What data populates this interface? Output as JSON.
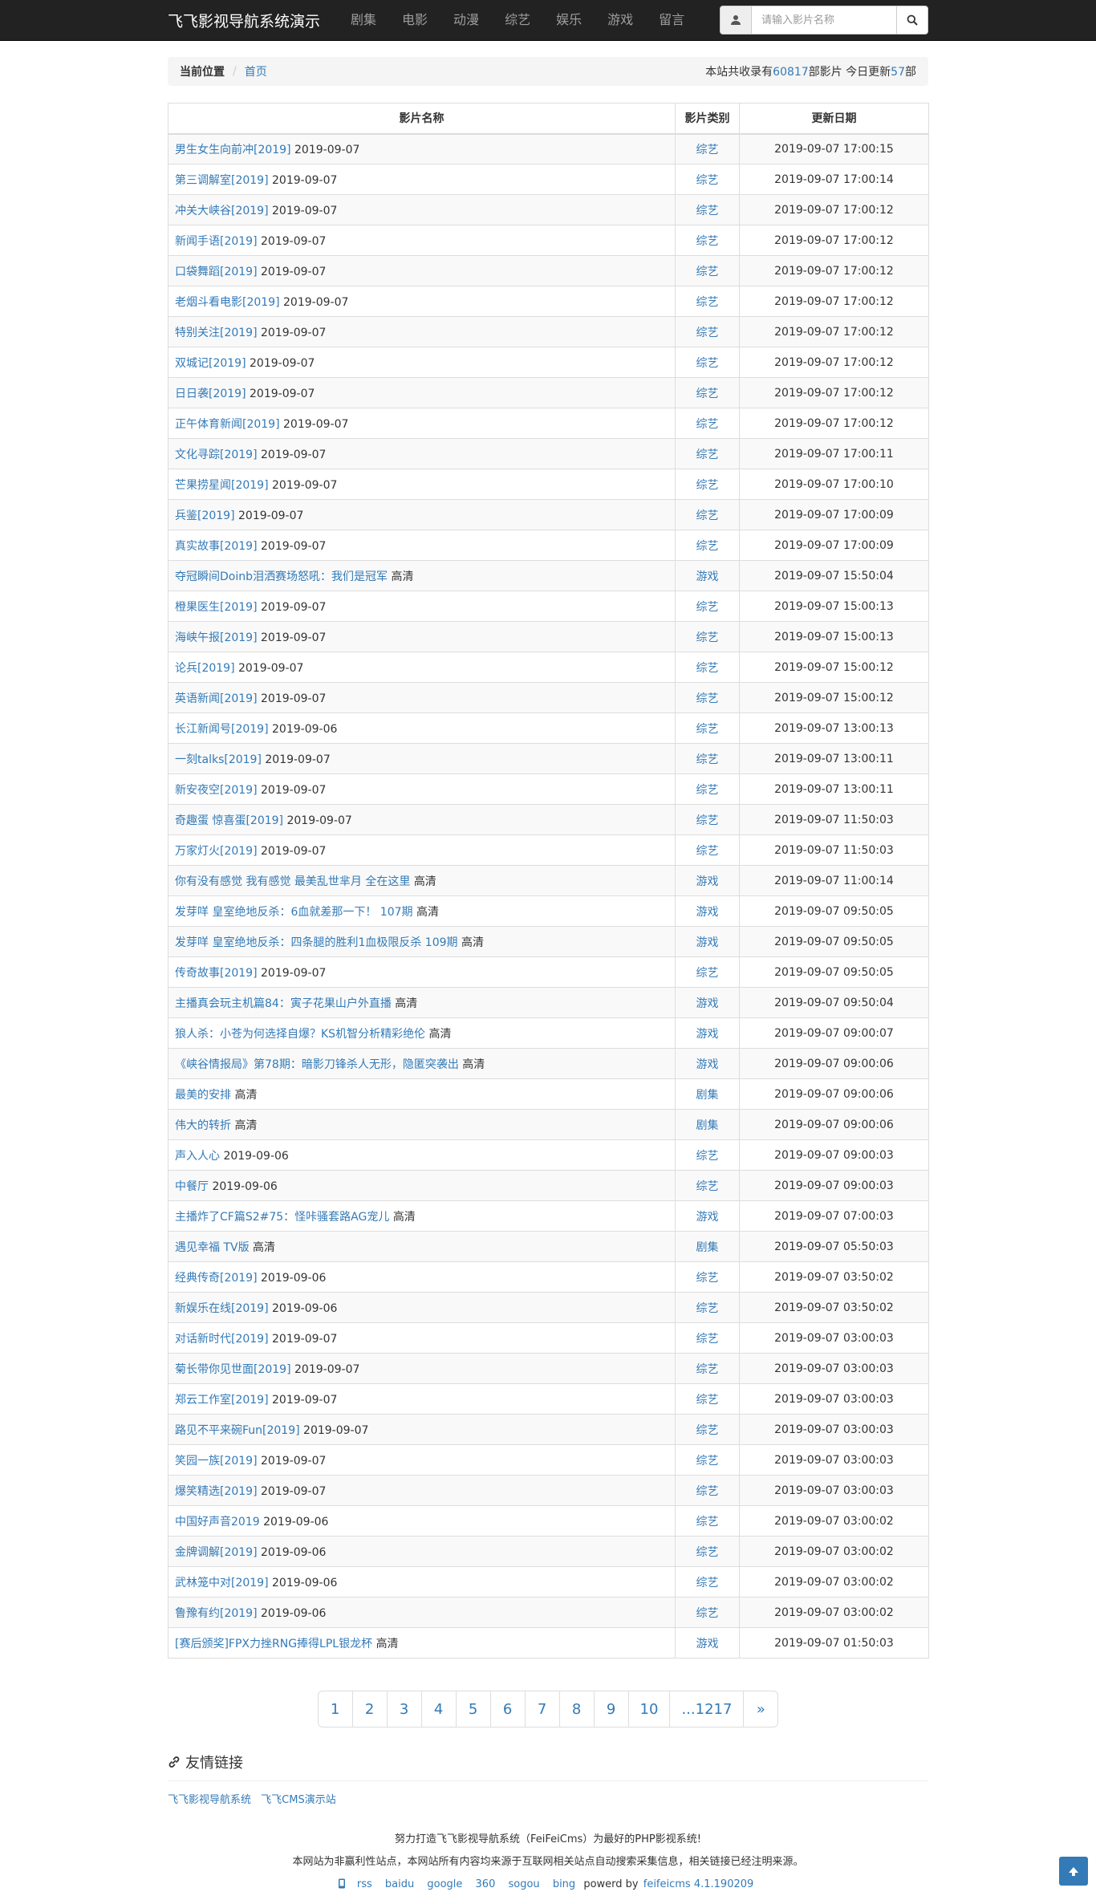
{
  "navbar": {
    "brand": "飞飞影视导航系统演示",
    "links": [
      "剧集",
      "电影",
      "动漫",
      "综艺",
      "娱乐",
      "游戏",
      "留言"
    ],
    "search_placeholder": "请输入影片名称"
  },
  "breadcrumb": {
    "current": "当前位置",
    "home": "首页",
    "stats_prefix": "本站共收录有",
    "total": "60817",
    "stats_mid": "部影片 今日更新",
    "today": "57",
    "stats_suffix": "部"
  },
  "table": {
    "headers": [
      "影片名称",
      "影片类别",
      "更新日期"
    ],
    "rows": [
      {
        "title": "男生女生向前冲[2019]",
        "note": "2019-09-07",
        "type": "综艺",
        "date": "2019-09-07 17:00:15"
      },
      {
        "title": "第三调解室[2019]",
        "note": "2019-09-07",
        "type": "综艺",
        "date": "2019-09-07 17:00:14"
      },
      {
        "title": "冲关大峡谷[2019]",
        "note": "2019-09-07",
        "type": "综艺",
        "date": "2019-09-07 17:00:12"
      },
      {
        "title": "新闻手语[2019]",
        "note": "2019-09-07",
        "type": "综艺",
        "date": "2019-09-07 17:00:12"
      },
      {
        "title": "口袋舞蹈[2019]",
        "note": "2019-09-07",
        "type": "综艺",
        "date": "2019-09-07 17:00:12"
      },
      {
        "title": "老烟斗看电影[2019]",
        "note": "2019-09-07",
        "type": "综艺",
        "date": "2019-09-07 17:00:12"
      },
      {
        "title": "特别关注[2019]",
        "note": "2019-09-07",
        "type": "综艺",
        "date": "2019-09-07 17:00:12"
      },
      {
        "title": "双城记[2019]",
        "note": "2019-09-07",
        "type": "综艺",
        "date": "2019-09-07 17:00:12"
      },
      {
        "title": "日日袭[2019]",
        "note": "2019-09-07",
        "type": "综艺",
        "date": "2019-09-07 17:00:12"
      },
      {
        "title": "正午体育新闻[2019]",
        "note": "2019-09-07",
        "type": "综艺",
        "date": "2019-09-07 17:00:12"
      },
      {
        "title": "文化寻踪[2019]",
        "note": "2019-09-07",
        "type": "综艺",
        "date": "2019-09-07 17:00:11"
      },
      {
        "title": "芒果捞星闻[2019]",
        "note": "2019-09-07",
        "type": "综艺",
        "date": "2019-09-07 17:00:10"
      },
      {
        "title": "兵鉴[2019]",
        "note": "2019-09-07",
        "type": "综艺",
        "date": "2019-09-07 17:00:09"
      },
      {
        "title": "真实故事[2019]",
        "note": "2019-09-07",
        "type": "综艺",
        "date": "2019-09-07 17:00:09"
      },
      {
        "title": "夺冠瞬间Doinb泪洒赛场怒吼：我们是冠军",
        "note": "高清",
        "type": "游戏",
        "date": "2019-09-07 15:50:04"
      },
      {
        "title": "橙果医生[2019]",
        "note": "2019-09-07",
        "type": "综艺",
        "date": "2019-09-07 15:00:13"
      },
      {
        "title": "海峡午报[2019]",
        "note": "2019-09-07",
        "type": "综艺",
        "date": "2019-09-07 15:00:13"
      },
      {
        "title": "论兵[2019]",
        "note": "2019-09-07",
        "type": "综艺",
        "date": "2019-09-07 15:00:12"
      },
      {
        "title": "英语新闻[2019]",
        "note": "2019-09-07",
        "type": "综艺",
        "date": "2019-09-07 15:00:12"
      },
      {
        "title": "长江新闻号[2019]",
        "note": "2019-09-06",
        "type": "综艺",
        "date": "2019-09-07 13:00:13"
      },
      {
        "title": "一刻talks[2019]",
        "note": "2019-09-07",
        "type": "综艺",
        "date": "2019-09-07 13:00:11"
      },
      {
        "title": "新安夜空[2019]",
        "note": "2019-09-07",
        "type": "综艺",
        "date": "2019-09-07 13:00:11"
      },
      {
        "title": "奇趣蛋 惊喜蛋[2019]",
        "note": "2019-09-07",
        "type": "综艺",
        "date": "2019-09-07 11:50:03"
      },
      {
        "title": "万家灯火[2019]",
        "note": "2019-09-07",
        "type": "综艺",
        "date": "2019-09-07 11:50:03"
      },
      {
        "title": "你有没有感觉 我有感觉 最美乱世芈月 全在这里",
        "note": "高清",
        "type": "游戏",
        "date": "2019-09-07 11:00:14"
      },
      {
        "title": "发芽咩 皇室绝地反杀：6血就差那一下！ 107期",
        "note": "高清",
        "type": "游戏",
        "date": "2019-09-07 09:50:05"
      },
      {
        "title": "发芽咩 皇室绝地反杀：四条腿的胜利1血极限反杀 109期",
        "note": "高清",
        "type": "游戏",
        "date": "2019-09-07 09:50:05"
      },
      {
        "title": "传奇故事[2019]",
        "note": "2019-09-07",
        "type": "综艺",
        "date": "2019-09-07 09:50:05"
      },
      {
        "title": "主播真会玩主机篇84：寅子花果山户外直播",
        "note": "高清",
        "type": "游戏",
        "date": "2019-09-07 09:50:04"
      },
      {
        "title": "狼人杀：小苍为何选择自爆？KS机智分析精彩绝伦",
        "note": "高清",
        "type": "游戏",
        "date": "2019-09-07 09:00:07"
      },
      {
        "title": "《峡谷情报局》第78期：暗影刀锋杀人无形，隐匿突袭出",
        "note": "高清",
        "type": "游戏",
        "date": "2019-09-07 09:00:06"
      },
      {
        "title": "最美的安排",
        "note": "高清",
        "type": "剧集",
        "date": "2019-09-07 09:00:06"
      },
      {
        "title": "伟大的转折",
        "note": "高清",
        "type": "剧集",
        "date": "2019-09-07 09:00:06"
      },
      {
        "title": "声入人心",
        "note": "2019-09-06",
        "type": "综艺",
        "date": "2019-09-07 09:00:03"
      },
      {
        "title": "中餐厅",
        "note": "2019-09-06",
        "type": "综艺",
        "date": "2019-09-07 09:00:03"
      },
      {
        "title": "主播炸了CF篇S2#75：怪咔骚套路AG宠儿",
        "note": "高清",
        "type": "游戏",
        "date": "2019-09-07 07:00:03"
      },
      {
        "title": "遇见幸福 TV版",
        "note": "高清",
        "type": "剧集",
        "date": "2019-09-07 05:50:03"
      },
      {
        "title": "经典传奇[2019]",
        "note": "2019-09-06",
        "type": "综艺",
        "date": "2019-09-07 03:50:02"
      },
      {
        "title": "新娱乐在线[2019]",
        "note": "2019-09-06",
        "type": "综艺",
        "date": "2019-09-07 03:50:02"
      },
      {
        "title": "对话新时代[2019]",
        "note": "2019-09-07",
        "type": "综艺",
        "date": "2019-09-07 03:00:03"
      },
      {
        "title": "菊长带你见世面[2019]",
        "note": "2019-09-07",
        "type": "综艺",
        "date": "2019-09-07 03:00:03"
      },
      {
        "title": "郑云工作室[2019]",
        "note": "2019-09-07",
        "type": "综艺",
        "date": "2019-09-07 03:00:03"
      },
      {
        "title": "路见不平来碗Fun[2019]",
        "note": "2019-09-07",
        "type": "综艺",
        "date": "2019-09-07 03:00:03"
      },
      {
        "title": "笑园一族[2019]",
        "note": "2019-09-07",
        "type": "综艺",
        "date": "2019-09-07 03:00:03"
      },
      {
        "title": "爆笑精选[2019]",
        "note": "2019-09-07",
        "type": "综艺",
        "date": "2019-09-07 03:00:03"
      },
      {
        "title": "中国好声音2019",
        "note": "2019-09-06",
        "type": "综艺",
        "date": "2019-09-07 03:00:02"
      },
      {
        "title": "金牌调解[2019]",
        "note": "2019-09-06",
        "type": "综艺",
        "date": "2019-09-07 03:00:02"
      },
      {
        "title": "武林笼中对[2019]",
        "note": "2019-09-06",
        "type": "综艺",
        "date": "2019-09-07 03:00:02"
      },
      {
        "title": "鲁豫有约[2019]",
        "note": "2019-09-06",
        "type": "综艺",
        "date": "2019-09-07 03:00:02"
      },
      {
        "title": "[赛后颁奖]FPX力挫RNG捧得LPL银龙杯",
        "note": "高清",
        "type": "游戏",
        "date": "2019-09-07 01:50:03"
      }
    ]
  },
  "pagination": [
    "1",
    "2",
    "3",
    "4",
    "5",
    "6",
    "7",
    "8",
    "9",
    "10",
    "...1217",
    "»"
  ],
  "friend_links": {
    "title": "友情链接",
    "items": [
      "飞飞影视导航系统",
      "飞飞CMS演示站"
    ]
  },
  "footer": {
    "line1": "努力打造飞飞影视导航系统（FeiFeiCms）为最好的PHP影视系统!",
    "line2": "本网站为非赢利性站点，本网站所有内容均来源于互联网相关站点自动搜索采集信息，相关链接已经注明来源。",
    "links": [
      "rss",
      "baidu",
      "google",
      "360",
      "sogou",
      "bing"
    ],
    "powered_prefix": "powerd by",
    "powered_link": "feifeicms 4.1.190209"
  }
}
